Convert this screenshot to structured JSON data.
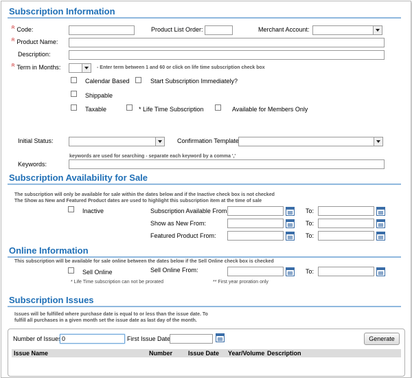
{
  "sections": {
    "subscription_info": "Subscription Information",
    "availability": "Subscription Availability for Sale",
    "online": "Online Information",
    "issues": "Subscription Issues"
  },
  "info": {
    "required_marker": "R",
    "code_label": "Code:",
    "product_list_order_label": "Product List Order:",
    "merchant_account_label": "Merchant Account:",
    "product_name_label": "Product Name:",
    "description_label": "Description:",
    "term_label": "Term in Months:",
    "term_hint": "- Enter term between 1 and 60 or click on life time subscription check box",
    "calendar_based": "Calendar Based",
    "start_immediately": "Start Subscription Immediately?",
    "shippable": "Shippable",
    "taxable": "Taxable",
    "life_time": "* Life Time Subscription",
    "members_only": "Available for Members Only",
    "initial_status_label": "Initial Status:",
    "confirmation_template_label": "Confirmation Template:",
    "keywords_hint": "keywords are used for searching - separate each keyword by a comma ','",
    "keywords_label": "Keywords:"
  },
  "availability": {
    "note1": "The subscription will only be available for sale within the dates below and if the Inactive check box is not checked",
    "note2": "The Show as New and Featured Product dates are used to highlight this subscription item at the time of sale",
    "inactive": "Inactive",
    "available_from": "Subscription Available From:",
    "show_new_from": "Show as New From:",
    "featured_from": "Featured Product From:",
    "to": "To:"
  },
  "online": {
    "note": "This subscription will be available for sale online between the dates below if the Sell Online check box is checked",
    "sell_online": "Sell Online",
    "sell_online_from": "Sell Online From:",
    "to": "To:",
    "life_time_note": "* Life Time subscription can not be prorated",
    "first_year_note": "** First year proration only"
  },
  "issues": {
    "note1": "Issues will be fulfilled where purchase date is equal to or less than the issue date. To",
    "note2": "fulfill all purchases in a given month set the issue date as last day of the month.",
    "number_of_issues_label": "Number of Issues:",
    "number_of_issues_value": "0",
    "first_issue_date_label": "First Issue Date:",
    "generate": "Generate",
    "columns": [
      "Issue Name",
      "Number",
      "Issue Date",
      "Year/Volume",
      "Description"
    ]
  }
}
